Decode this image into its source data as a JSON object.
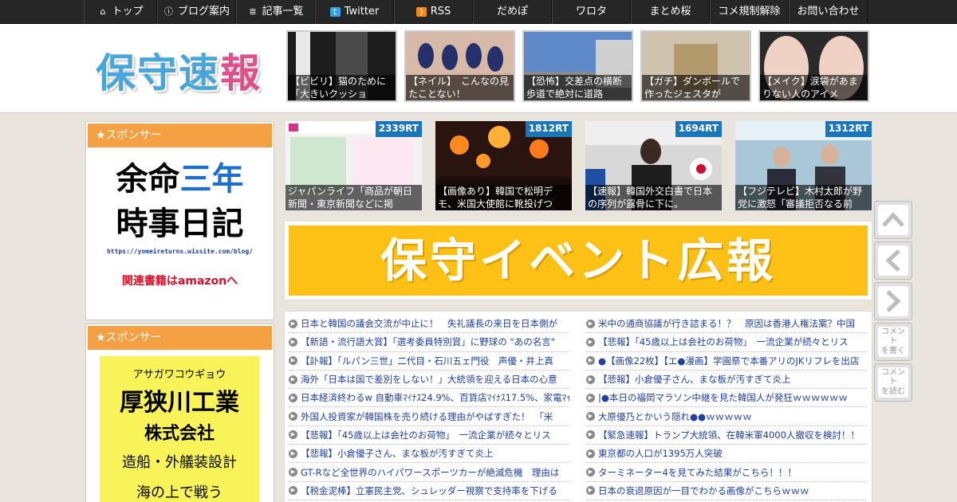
{
  "nav": {
    "items": [
      {
        "label": "トップ",
        "icon": "home-icon"
      },
      {
        "label": "ブログ案内",
        "icon": "info-icon"
      },
      {
        "label": "記事一覧",
        "icon": "list-icon"
      },
      {
        "label": "Twitter",
        "icon": "twitter-icon"
      },
      {
        "label": "RSS",
        "icon": "rss-icon"
      },
      {
        "label": "だめぽ",
        "icon": ""
      },
      {
        "label": "ワロタ",
        "icon": ""
      },
      {
        "label": "まとめ桜",
        "icon": ""
      },
      {
        "label": "コメ規制解除",
        "icon": ""
      },
      {
        "label": "お問い合わせ",
        "icon": ""
      }
    ]
  },
  "header": {
    "logo_main": "保守速",
    "logo_pink": "報",
    "featured": [
      {
        "caption": "【ビビリ】猫のために「大きいクッショ"
      },
      {
        "caption": "【ネイル】　こんなの見たことない！"
      },
      {
        "caption": "【恐怖】交差点の横断歩道で絶対に道路"
      },
      {
        "caption": "【ガチ】ダンボールで作ったジェスタが"
      },
      {
        "caption": "【メイク】涙袋があまりない人のアイメ"
      }
    ]
  },
  "sidebar": {
    "sponsor1": {
      "heading": "★スポンサー",
      "ad_line1a": "余命",
      "ad_line1b": "三年",
      "ad_line2": "時事日記",
      "ad_url": "https://yomeireturns.wixsite.com/blog/",
      "ad_link": "関連書籍はamazonへ"
    },
    "sponsor2": {
      "heading": "★スポンサー",
      "kana": "アサガワコウギョウ",
      "name1": "厚狭川工業",
      "name2": "株式会社",
      "desc": "造船・外艤装設計",
      "tail": "海の上で戦う"
    }
  },
  "rt_posts": [
    {
      "badge": "2339RT",
      "caption": "ジャパンライフ「商品が朝日新聞・東京新聞などに掲"
    },
    {
      "badge": "1812RT",
      "caption": "【画像あり】韓国で松明デモ、米国大使館に靴投げつ"
    },
    {
      "badge": "1694RT",
      "caption": "【速報】韓国外交白書で日本の序列が露骨に下に。"
    },
    {
      "badge": "1312RT",
      "caption": "【フジテレビ】木村太郎が野党に激怒「審議拒否なる前"
    }
  ],
  "event_banner": {
    "label": "保守イベント広報"
  },
  "news": {
    "left": [
      "日本と韓国の議会交流が中止に！　失礼議長の来日を日本側が",
      "【新語・流行語大賞】「選考委員特別賞」に野球の \"あの名言\"",
      "【訃報】「ルパン三世」二代目・石川五ェ門役　声優・井上真",
      "海外「日本は国で差別をしない！」大統領を迎える日本の心意",
      "日本経済終わるw 自動車ﾏｲﾅｽ24.9%、百貨店ﾏｲﾅｽ17.5%、家電ﾏｲ",
      "外国人投資家が韓国株を売り続ける理由がやばすぎた！　「米",
      "【悲報】「45歳以上は会社のお荷物」　一流企業が続々とリス",
      "【悲報】小倉優子さん、まな板が汚すぎて炎上",
      "GT-Rなど全世界のハイパワースポーツカーが絶滅危機　理由は",
      "【税金泥棒】立憲民主党、シュレッダー視察で支持率を下げる"
    ],
    "right": [
      "米中の通商協議が行き詰まる！？　原因は香港人権法案？中国",
      "【悲報】「45歳以上は会社のお荷物」　一流企業が続々とリス",
      "●【画像22枚】【エ●漫画】学園祭で本番アリのJKリフレを出店",
      "【悲報】小倉優子さん、まな板が汚すぎて炎上",
      "|●本日の福岡マラソン中継を見た韓国人が発狂ｗｗｗｗｗｗ",
      "大原優乃とかいう隠れ●●ｗｗｗｗｗ",
      "【緊急速報】トランプ大統領、在韓米軍4000人撤収を検討！！",
      "東京都の人口が1395万人突破",
      "ターミネーター4を見てみた結果がこちら！！！",
      "日本の衰退原因が一目でわかる画像がこちらｗｗｗ"
    ]
  },
  "side_buttons": {
    "up": "∧",
    "prev": "<",
    "next": ">",
    "write": "コメント\nを書く",
    "read": "コメント\nを読む"
  },
  "colors": {
    "nav_bg": "#262626",
    "accent_orange": "#f5a042",
    "rt_badge": "#1a76b9",
    "banner_yellow": "#fcc114"
  }
}
